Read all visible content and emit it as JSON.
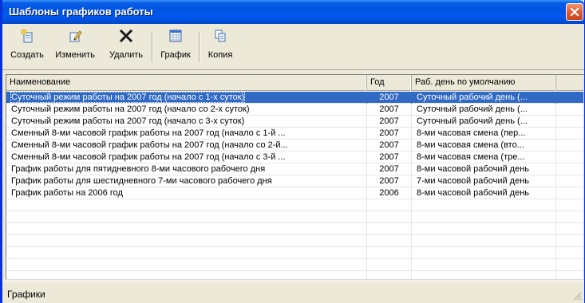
{
  "window": {
    "title": "Шаблоны графиков работы"
  },
  "toolbar": {
    "create_label": "Создать",
    "edit_label": "Изменить",
    "delete_label": "Удалить",
    "schedule_label": "График",
    "copy_label": "Копия"
  },
  "table": {
    "columns": [
      "Наименование",
      "Год",
      "Раб. день по умолчанию"
    ],
    "rows": [
      {
        "name": "Суточный режим работы на 2007 год (начало с 1-х суток)",
        "year": "2007",
        "day": "Суточный рабочий день (..."
      },
      {
        "name": "Суточный режим работы на 2007 год (начало со 2-х суток)",
        "year": "2007",
        "day": "Суточный рабочий день (..."
      },
      {
        "name": "Суточный режим работы на 2007 год (начало с 3-х суток)",
        "year": "2007",
        "day": "Суточный рабочий день (..."
      },
      {
        "name": "Сменный 8-ми часовой график работы на 2007 год (начало с 1-й ...",
        "year": "2007",
        "day": "8-ми часовая смена (пер..."
      },
      {
        "name": "Сменный 8-ми часовой график работы на 2007 год (начало со 2-й...",
        "year": "2007",
        "day": "8-ми часовая смена (вто..."
      },
      {
        "name": "Сменный 8-ми часовой график работы на 2007 год (начало с 3-й ...",
        "year": "2007",
        "day": "8-ми часовая смена (тре..."
      },
      {
        "name": "График работы для пятидневного 8-ми часового рабочего дня",
        "year": "2007",
        "day": "8-ми часовой рабочий день"
      },
      {
        "name": "График работы для шестидневного 7-ми часового рабочего дня",
        "year": "2007",
        "day": "7-ми часовой рабочий день"
      },
      {
        "name": "График работы на 2006 год",
        "year": "2006",
        "day": "8-ми часовой рабочий день"
      }
    ],
    "selected_row": 0
  },
  "status": {
    "text": "Графики"
  },
  "icons": {
    "create": "new-document-icon",
    "edit": "edit-pencil-icon",
    "delete": "delete-x-icon",
    "schedule": "calendar-grid-icon",
    "copy": "copy-documents-icon",
    "close": "close-icon"
  },
  "colors": {
    "title_bar": "#0054e3",
    "selection": "#316ac5",
    "close_button": "#e35a2f"
  }
}
